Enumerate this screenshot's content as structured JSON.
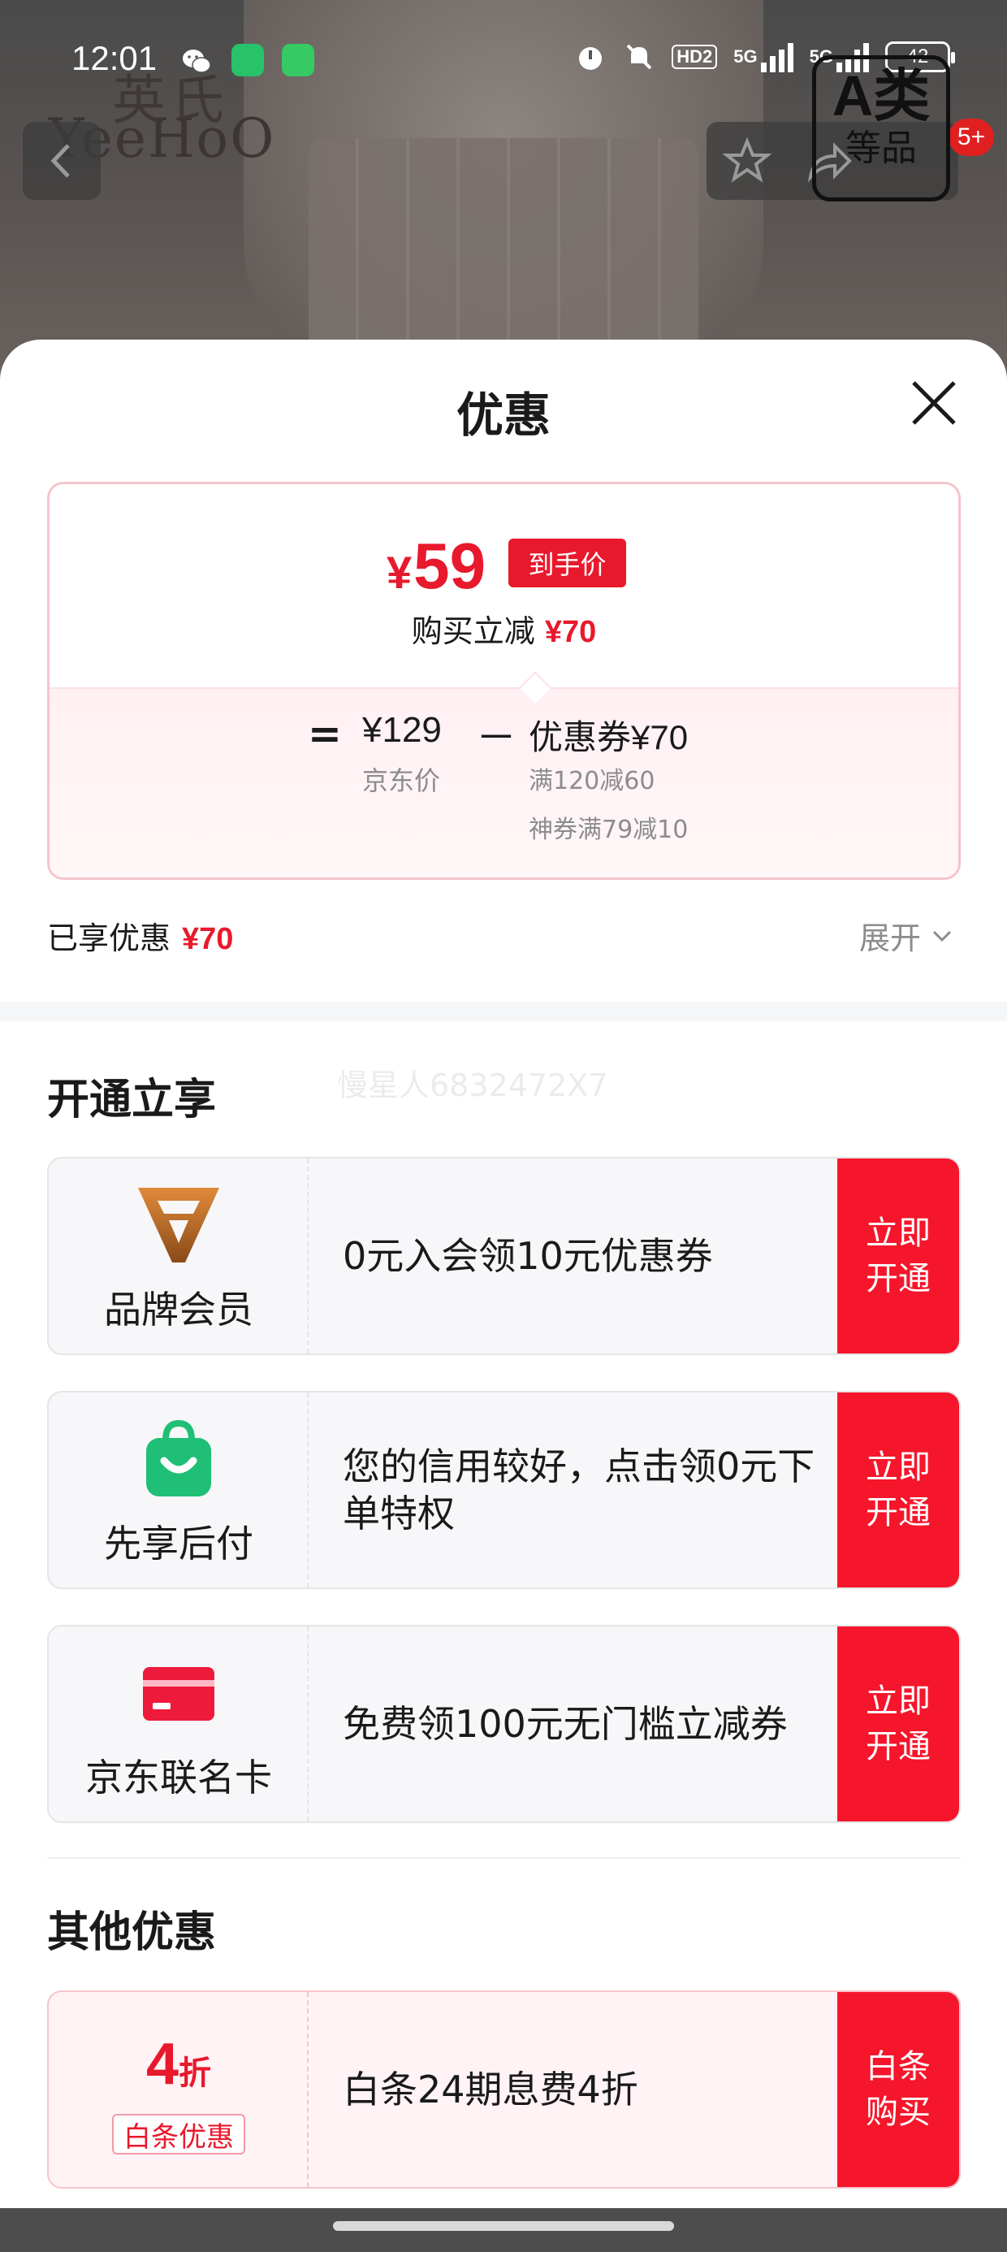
{
  "status_bar": {
    "time": "12:01",
    "network_1": "HD2",
    "network_2": "5G",
    "network_3": "5G",
    "battery": "42"
  },
  "background": {
    "brand_cn": "英氏",
    "brand_en": "YeeHoO",
    "cart_badge": "5+",
    "grade_letter": "A类",
    "grade_word": "等品"
  },
  "sheet": {
    "title": "优惠",
    "summary": {
      "currency": "¥",
      "final_price": "59",
      "final_price_tag": "到手价",
      "instant_cut_label": "购买立减",
      "instant_cut_amount": "¥70",
      "equals": "=",
      "jd_price": "¥129",
      "jd_price_label": "京东价",
      "minus": "－",
      "coupon_label": "优惠券",
      "coupon_amount": "¥70",
      "coupon_detail_1": "满120减60",
      "coupon_detail_2": "神券满79减10"
    },
    "enjoyed_label": "已享优惠",
    "enjoyed_amount": "¥70",
    "expand_label": "展开",
    "watermark": "慢星人6832472X7",
    "section_open": "开通立享",
    "offers": [
      {
        "name": "品牌会员",
        "desc": "0元入会领10元优惠券",
        "button": "立即开通",
        "icon": "brand-member-v-icon"
      },
      {
        "name": "先享后付",
        "desc": "您的信用较好，点击领0元下单特权",
        "button": "立即开通",
        "icon": "shopping-bag-smile-icon"
      },
      {
        "name": "京东联名卡",
        "desc": "免费领100元无门槛立减券",
        "button": "立即开通",
        "icon": "credit-card-icon"
      }
    ],
    "section_other": "其他优惠",
    "other_offer": {
      "discount_number": "4",
      "discount_unit": "折",
      "tag": "白条优惠",
      "desc": "白条24期息费4折",
      "button": "白条购买"
    }
  },
  "colors": {
    "accent_red": "#e8192c",
    "button_red": "#f5162b",
    "card_border_pink": "#f6c4cb",
    "gray_text": "#8c8c8c"
  }
}
